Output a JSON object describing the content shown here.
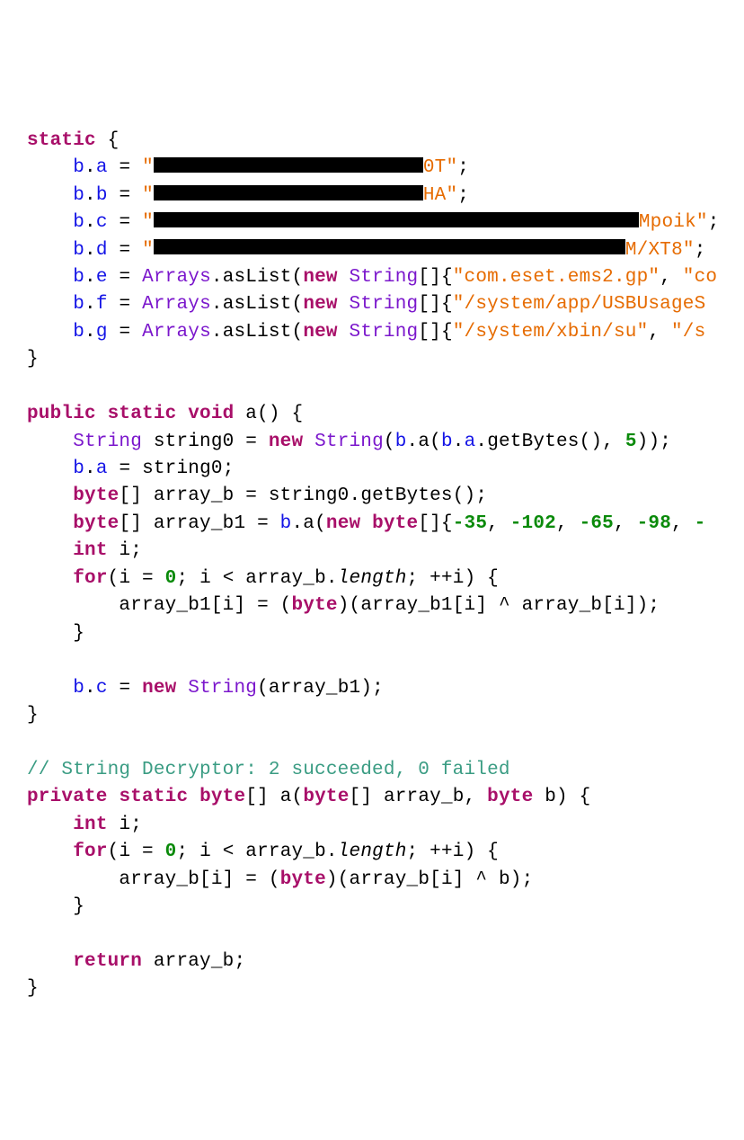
{
  "tokens": {
    "static": "static",
    "public": "public",
    "private": "private",
    "void": "void",
    "new": "new",
    "int": "int",
    "for": "for",
    "return": "return",
    "String": "String",
    "byte": "byte",
    "byteArr": "byte",
    "Arrays": "Arrays",
    "asList": "asList",
    "getBytes": "getBytes",
    "length": "length"
  },
  "vars": {
    "ba": "b",
    "bb": "b",
    "bc": "b",
    "bd": "b",
    "be": "b",
    "bf": "b",
    "bg": "b",
    "a": "a",
    "b": "b",
    "c": "c",
    "d": "d",
    "e": "e",
    "f": "f",
    "g": "g",
    "string0": "string0",
    "array_b": "array_b",
    "array_b1": "array_b1",
    "i": "i"
  },
  "strings": {
    "s1_open": "\"",
    "s1_suffix": "0T\"",
    "s2_open": "\"",
    "s2_suffix": "HA\"",
    "s3_open": "\"",
    "s3_suffix": "Mpoik\"",
    "s4_open": "\"",
    "s4_suffix": "M/XT8\"",
    "arr1_a": "\"com.eset.ems2.gp\"",
    "arr1_b": "\"co",
    "arr2_a": "\"/system/app/USBUsageS",
    "arr3_a": "\"/system/xbin/su\"",
    "arr3_b": "\"/s"
  },
  "numbers": {
    "five": "5",
    "n1": "-35",
    "n2": "-102",
    "n3": "-65",
    "n4": "-98",
    "n5trail": "-",
    "zero": "0"
  },
  "comment": "// String Decryptor: 2 succeeded, 0 failed",
  "methodA": "a",
  "methodA2": "a",
  "classB": "b"
}
